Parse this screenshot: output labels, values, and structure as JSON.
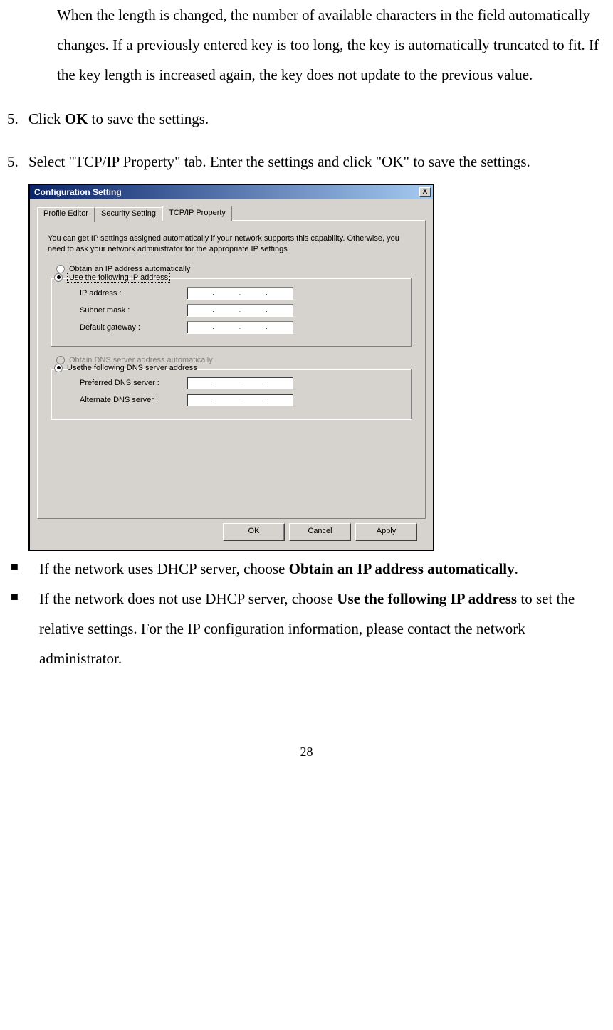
{
  "para_truncate": "When the length is changed, the number of available characters in the field automatically changes. If a previously entered key is too long, the key is automatically truncated to fit. If the key length is increased again, the key does not update to the previous value.",
  "step5a": {
    "num": "5.",
    "pre": "Click ",
    "bold": "OK",
    "post": " to save the settings."
  },
  "step5b": {
    "num": "5.",
    "text": "Select \"TCP/IP Property\" tab.    Enter the settings and click \"OK\" to save the settings."
  },
  "dialog": {
    "title": "Configuration Setting",
    "close": "X",
    "tabs": {
      "profile": "Profile Editor",
      "security": "Security Setting",
      "tcpip": "TCP/IP Property"
    },
    "panel_text": "You can get IP settings assigned automatically if your network supports this capability. Otherwise, you need to ask your network administrator for the appropriate IP settings",
    "radio_obtain_ip": "Obtain an IP address automatically",
    "radio_use_ip": "Use the following IP address",
    "labels": {
      "ip": "IP address :",
      "subnet": "Subnet mask :",
      "gateway": "Default gateway :",
      "pref_dns": "Preferred DNS server :",
      "alt_dns": "Alternate DNS server :"
    },
    "radio_obtain_dns": "Obtain DNS server address automatically",
    "radio_use_dns": "Usethe following DNS server address",
    "buttons": {
      "ok": "OK",
      "cancel": "Cancel",
      "apply": "Apply"
    }
  },
  "bullet1": {
    "pre": "If the network uses DHCP server, choose ",
    "bold": "Obtain an IP address automatically",
    "post": "."
  },
  "bullet2": {
    "pre": "If the network does not use DHCP server, choose ",
    "bold": "Use the following IP address",
    "post": " to set the relative settings.    For the IP configuration information, please contact the network administrator."
  },
  "page_number": "28"
}
